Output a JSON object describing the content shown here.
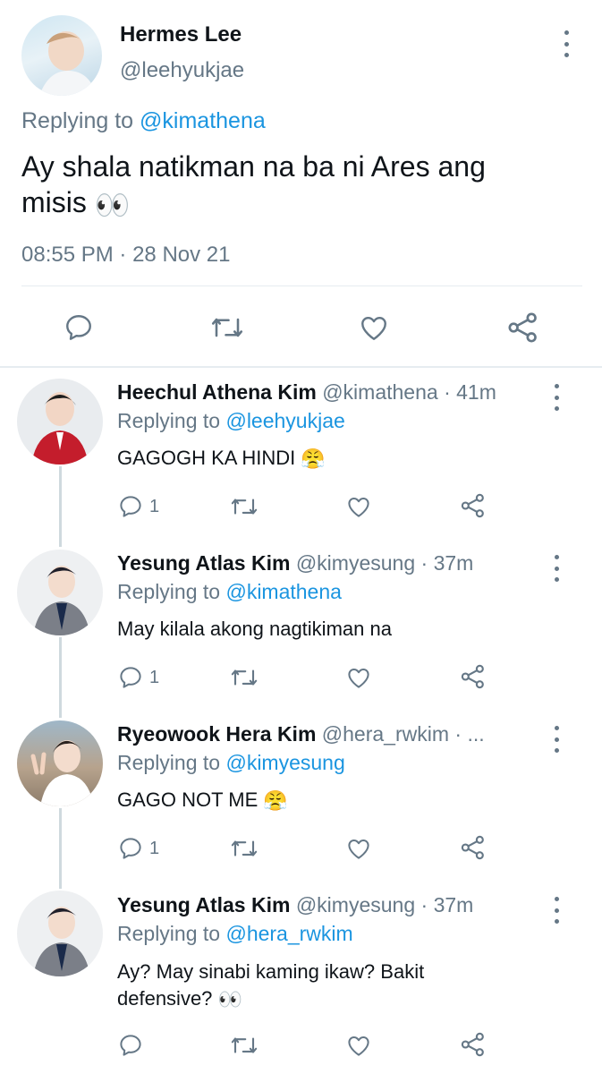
{
  "main_tweet": {
    "name": "Hermes Lee",
    "handle": "@leehyukjae",
    "replying_prefix": "Replying to",
    "replying_to": "@kimathena",
    "text": "Ay shala natikman na ba ni Ares ang misis",
    "emoji": "👀",
    "time": "08:55 PM",
    "separator": "·",
    "date": "28 Nov 21"
  },
  "replies": [
    {
      "name": "Heechul Athena Kim",
      "handle": "@kimathena",
      "meta": "· 41m",
      "replying_prefix": "Replying to",
      "replying_to": "@leehyukjae",
      "text": "GAGOGH KA HINDI",
      "emoji": "😤",
      "reply_count": "1"
    },
    {
      "name": "Yesung Atlas Kim",
      "handle": "@kimyesung",
      "meta": "· 37m",
      "replying_prefix": "Replying to",
      "replying_to": "@kimathena",
      "text": "May kilala akong nagtikiman na",
      "emoji": "",
      "reply_count": "1"
    },
    {
      "name": "Ryeowook Hera Kim",
      "handle": "@hera_rwkim",
      "meta": "· ...",
      "replying_prefix": "Replying to",
      "replying_to": "@kimyesung",
      "text": "GAGO NOT ME",
      "emoji": "😤",
      "reply_count": "1"
    },
    {
      "name": "Yesung Atlas Kim",
      "handle": "@kimyesung",
      "meta": "· 37m",
      "replying_prefix": "Replying to",
      "replying_to": "@hera_rwkim",
      "text_line1": "Ay? May sinabi kaming ikaw? Bakit",
      "text_line2": "defensive?",
      "emoji": "👀",
      "reply_count": ""
    }
  ],
  "icons": [
    "more-icon",
    "reply-icon",
    "retweet-icon",
    "like-icon",
    "share-icon"
  ],
  "colors": {
    "link": "#1b95e0",
    "muted": "#657786",
    "thread_line": "#cfd9de",
    "divider": "#e6ecf0"
  }
}
